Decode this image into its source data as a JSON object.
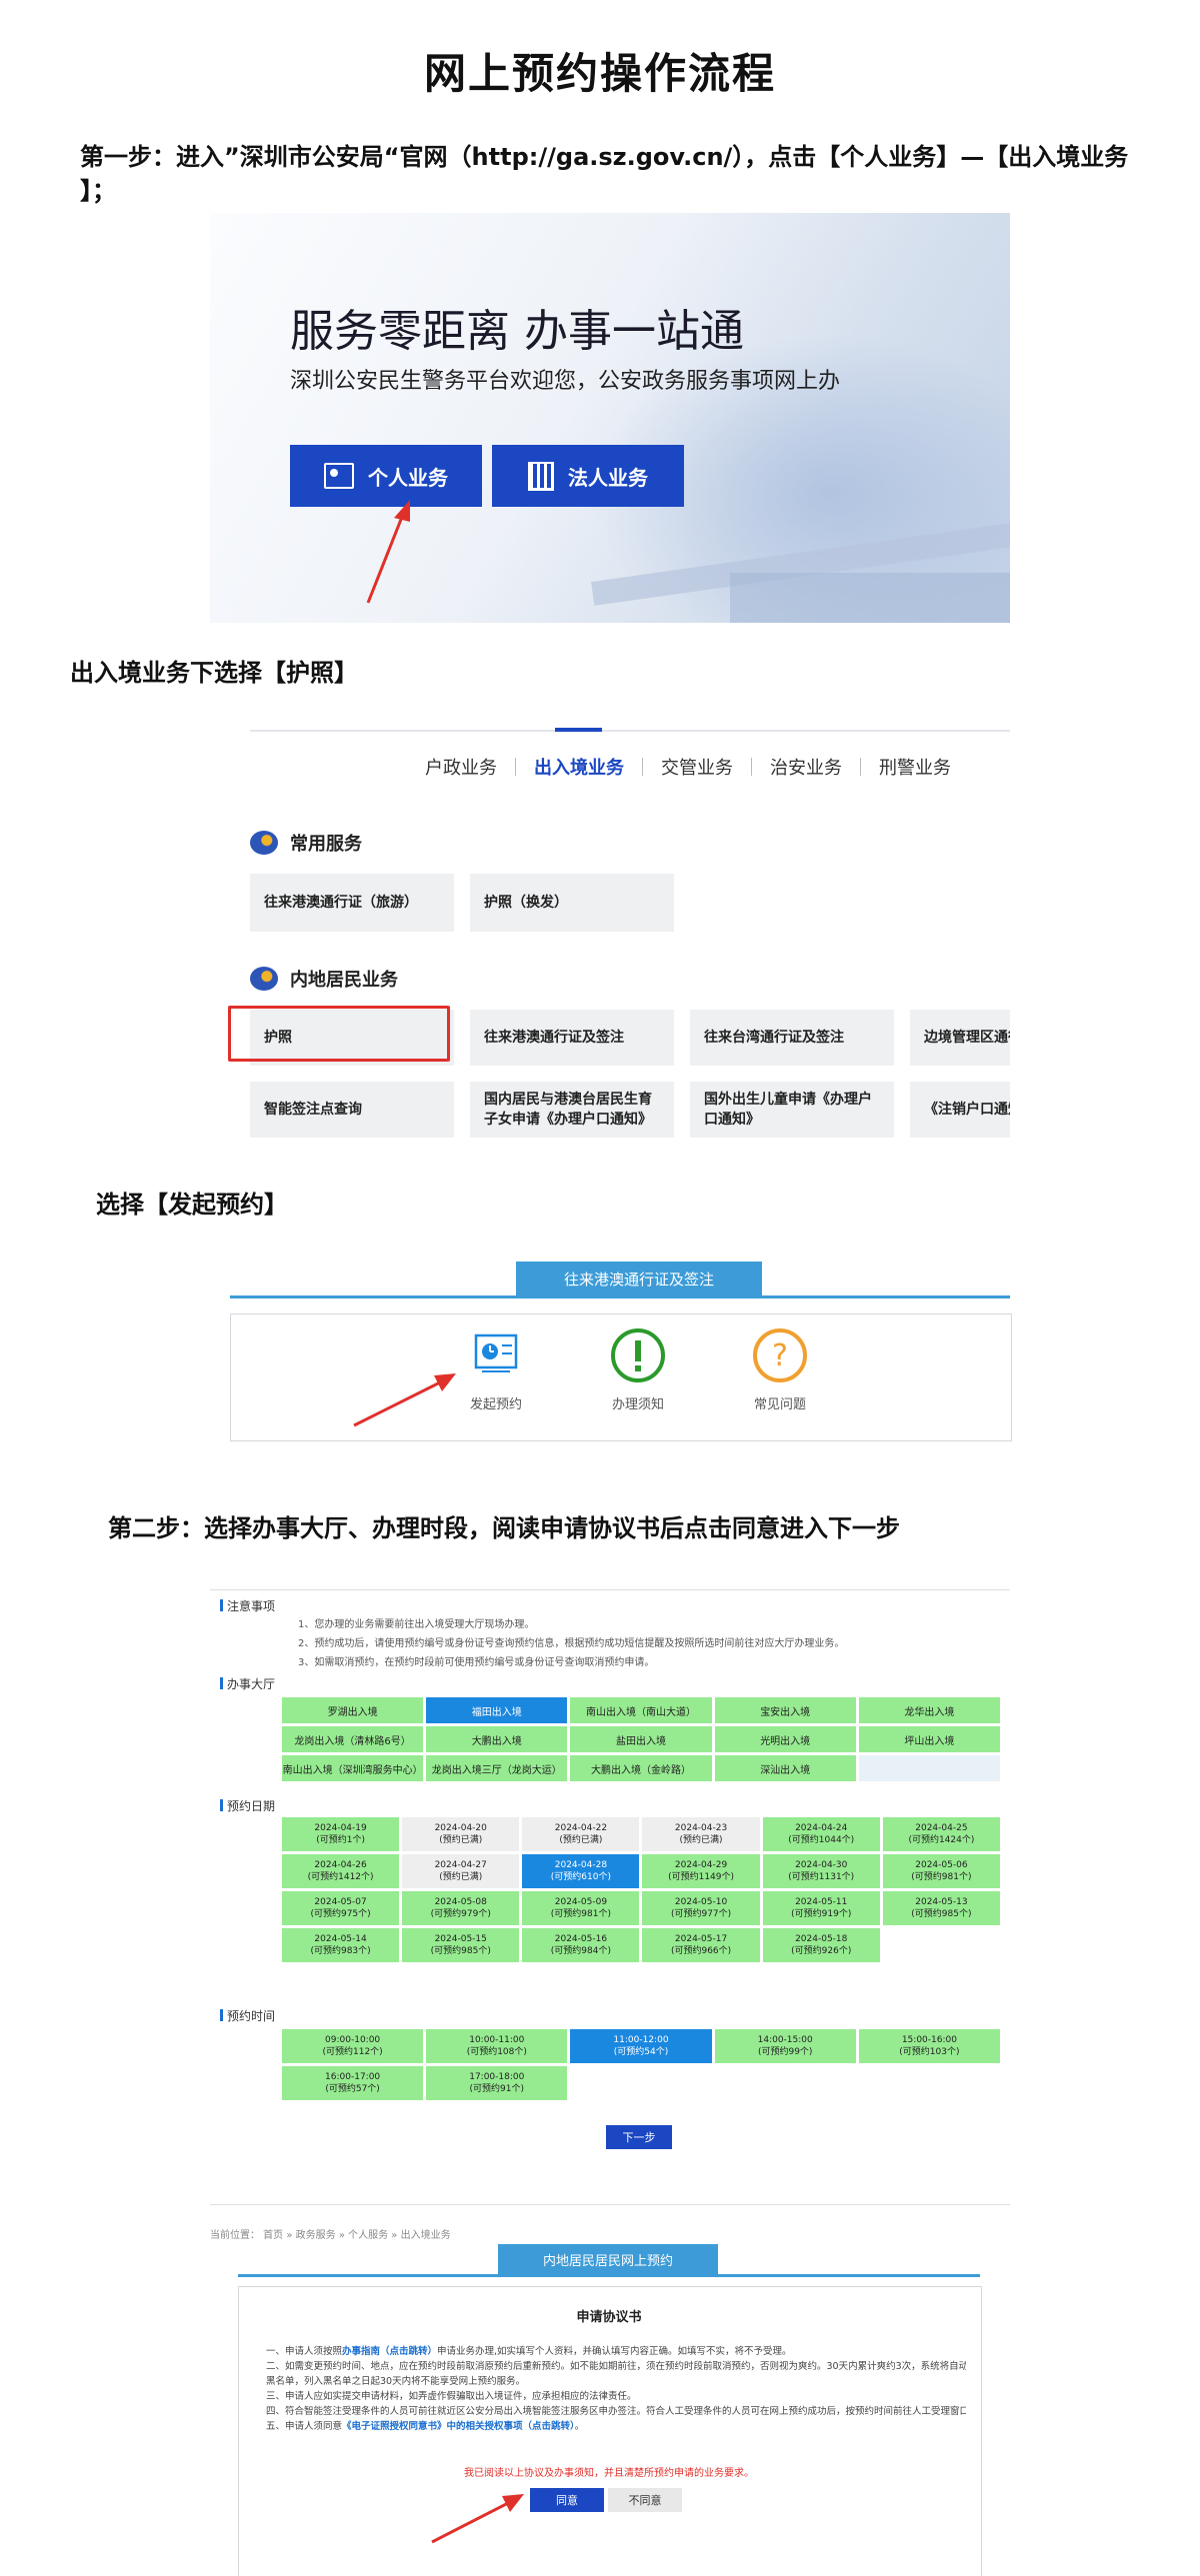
{
  "title": "网上预约操作流程",
  "step1": {
    "text": "第一步：进入”深圳市公安局“官网（http://ga.sz.gov.cn/），点击【个人业务】—【出入境业务",
    "text_cont": "】；"
  },
  "hero": {
    "heading": "服务零距离 办事一站通",
    "subheading": "深圳公安民生警务平台欢迎您，公安政务服务事项网上办",
    "btn_personal": "个人业务",
    "btn_legal": "法人业务"
  },
  "caption_passport": "出入境业务下选择【护照】",
  "menu": {
    "nav": [
      "户政业务",
      "出入境业务",
      "交管业务",
      "治安业务",
      "刑警业务"
    ],
    "active_index": 1,
    "common_title": "常用服务",
    "common_items": [
      "往来港澳通行证（旅游）",
      "护照（换发）"
    ],
    "mainland_title": "内地居民业务",
    "row1": [
      "护照",
      "往来港澳通行证及签注",
      "往来台湾通行证及签注",
      "边境管理区通行"
    ],
    "row2": [
      "智能签注点查询",
      "国内居民与港澳台居民生育子女申请《办理户口通知》",
      "国外出生儿童申请《办理户口通知》",
      "《注销户口通知"
    ]
  },
  "caption_start": "选择【发起预约】",
  "entry": {
    "tab": "往来港澳通行证及签注",
    "ops": [
      "发起预约",
      "办理须知",
      "常见问题"
    ]
  },
  "step2": "第二步：选择办事大厅、办理时段，阅读申请协议书后点击同意进入下一步",
  "schedule": {
    "notes_label": "注意事项",
    "notes": [
      "1、您办理的业务需要前往出入境受理大厅现场办理。",
      "2、预约成功后，请使用预约编号或身份证号查询预约信息，根据预约成功短信提醒及按照所选时间前往对应大厅办理业务。",
      "3、如需取消预约，在预约时段前可使用预约编号或身份证号查询取消预约申请。"
    ],
    "hall_label": "办事大厅",
    "halls": [
      "罗湖出入境",
      "福田出入境",
      "南山出入境（南山大道）",
      "宝安出入境",
      "龙华出入境",
      "龙岗出入境（清林路6号）",
      "大鹏出入境",
      "盐田出入境",
      "光明出入境",
      "坪山出入境",
      "南山出入境（深圳湾服务中心）",
      "龙岗出入境三厅（龙岗大运）",
      "大鹏出入境（金岭路）",
      "深汕出入境",
      ""
    ],
    "hall_selected": 1,
    "date_label": "预约日期",
    "dates": [
      {
        "d": "2024-04-19",
        "n": "(可预约1个)",
        "s": "g"
      },
      {
        "d": "2024-04-20",
        "n": "(预约已满)",
        "s": "x"
      },
      {
        "d": "2024-04-22",
        "n": "(预约已满)",
        "s": "x"
      },
      {
        "d": "2024-04-23",
        "n": "(预约已满)",
        "s": "x"
      },
      {
        "d": "2024-04-24",
        "n": "(可预约1044个)",
        "s": "g"
      },
      {
        "d": "2024-04-25",
        "n": "(可预约1424个)",
        "s": "g"
      },
      {
        "d": "2024-04-26",
        "n": "(可预约1412个)",
        "s": "g"
      },
      {
        "d": "2024-04-27",
        "n": "(预约已满)",
        "s": "x"
      },
      {
        "d": "2024-04-28",
        "n": "(可预约610个)",
        "s": "s"
      },
      {
        "d": "2024-04-29",
        "n": "(可预约1149个)",
        "s": "g"
      },
      {
        "d": "2024-04-30",
        "n": "(可预约1131个)",
        "s": "g"
      },
      {
        "d": "2024-05-06",
        "n": "(可预约981个)",
        "s": "g"
      },
      {
        "d": "2024-05-07",
        "n": "(可预约975个)",
        "s": "g"
      },
      {
        "d": "2024-05-08",
        "n": "(可预约979个)",
        "s": "g"
      },
      {
        "d": "2024-05-09",
        "n": "(可预约981个)",
        "s": "g"
      },
      {
        "d": "2024-05-10",
        "n": "(可预约977个)",
        "s": "g"
      },
      {
        "d": "2024-05-11",
        "n": "(可预约919个)",
        "s": "g"
      },
      {
        "d": "2024-05-13",
        "n": "(可预约985个)",
        "s": "g"
      },
      {
        "d": "2024-05-14",
        "n": "(可预约983个)",
        "s": "g"
      },
      {
        "d": "2024-05-15",
        "n": "(可预约985个)",
        "s": "g"
      },
      {
        "d": "2024-05-16",
        "n": "(可预约984个)",
        "s": "g"
      },
      {
        "d": "2024-05-17",
        "n": "(可预约966个)",
        "s": "g"
      },
      {
        "d": "2024-05-18",
        "n": "(可预约926个)",
        "s": "g"
      }
    ],
    "time_label": "预约时间",
    "times": [
      {
        "t": "09:00-10:00",
        "n": "(可预约112个)",
        "s": "g"
      },
      {
        "t": "10:00-11:00",
        "n": "(可预约108个)",
        "s": "g"
      },
      {
        "t": "11:00-12:00",
        "n": "(可预约54个)",
        "s": "s"
      },
      {
        "t": "14:00-15:00",
        "n": "(可预约99个)",
        "s": "g"
      },
      {
        "t": "15:00-16:00",
        "n": "(可预约103个)",
        "s": "g"
      },
      {
        "t": "16:00-17:00",
        "n": "(可预约57个)",
        "s": "g"
      },
      {
        "t": "17:00-18:00",
        "n": "(可预约91个)",
        "s": "g"
      }
    ],
    "next_btn": "下一步"
  },
  "agreement": {
    "breadcrumb": "当前位置：  首页   » 政务服务   » 个人服务   » 出入境业务",
    "tab": "内地居民居民网上预约",
    "title": "申请协议书",
    "lines": [
      {
        "a": "一、申请人须按照",
        "l": "办事指南（点击跳转）",
        "b": "申请业务办理,如实填写个人资料，并确认填写内容正确。如填写不实，将不予受理。"
      },
      {
        "a": "二、如需变更预约时间、地点，应在预约时段前取消原预约后重新预约。如不能如期前往，须在预约时段前取消预约，否则视为爽约。30天内累计爽约3次，系统将自动列入",
        "l": "",
        "b": ""
      },
      {
        "a": "黑名单，列入黑名单之日起30天内将不能享受网上预约服务。",
        "l": "",
        "b": ""
      },
      {
        "a": "三、申请人应如实提交申请材料，如弄虚作假骗取出入境证件，应承担相应的法律责任。",
        "l": "",
        "b": ""
      },
      {
        "a": "四、符合智能签注受理条件的人员可前往就近区公安分局出入境智能签注服务区申办签注。符合人工受理条件的人员可在网上预约成功后，按预约时间前往人工受理窗口。",
        "l": "",
        "b": ""
      },
      {
        "a": "五、申请人须同意",
        "l": "《电子证照授权同意书》中的相关授权事项（点击跳转）",
        "b": "。"
      }
    ],
    "red_note": "我已阅读以上协议及办事须知，并且清楚所预约申请的业务要求。",
    "agree_btn": "同意",
    "disagree_btn": "不同意"
  },
  "colors": {
    "accent_blue": "#1b47c2",
    "green_slot": "#96eb90",
    "selected_slot": "#1b88e0",
    "highlight_red": "#e0302a"
  }
}
